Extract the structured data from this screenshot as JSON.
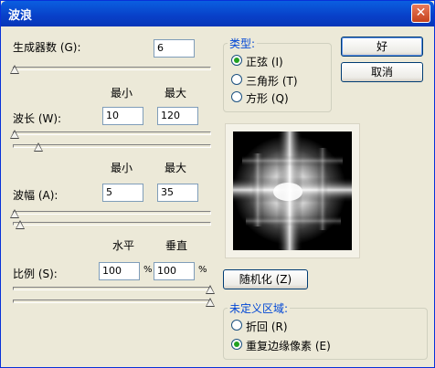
{
  "window": {
    "title": "波浪",
    "close_label": "✕"
  },
  "generators": {
    "label": "生成器数 (G):",
    "value": "6"
  },
  "minmax": {
    "min": "最小",
    "max": "最大"
  },
  "wavelength": {
    "label": "波长 (W):",
    "min": "10",
    "max": "120",
    "min_level": 0.0,
    "max_level": 0.12
  },
  "amplitude": {
    "label": "波幅 (A):",
    "min": "5",
    "max": "35",
    "min_level": 0.0,
    "max_level": 0.04
  },
  "scale": {
    "label": "比例 (S):",
    "h_header": "水平",
    "v_header": "垂直",
    "horizontal": "100",
    "vertical": "100",
    "unit": "%",
    "h_level": 1.0,
    "v_level": 1.0
  },
  "buttons": {
    "ok": "好",
    "cancel": "取消",
    "randomize": "随机化 (Z)"
  },
  "type_group": {
    "title": "类型:",
    "options": [
      {
        "label": "正弦 (I)",
        "checked": true
      },
      {
        "label": "三角形 (T)",
        "checked": false
      },
      {
        "label": "方形 (Q)",
        "checked": false
      }
    ]
  },
  "undefined_group": {
    "title": "未定义区域:",
    "options": [
      {
        "label": "折回 (R)",
        "checked": false
      },
      {
        "label": "重复边缘像素 (E)",
        "checked": true
      }
    ]
  }
}
